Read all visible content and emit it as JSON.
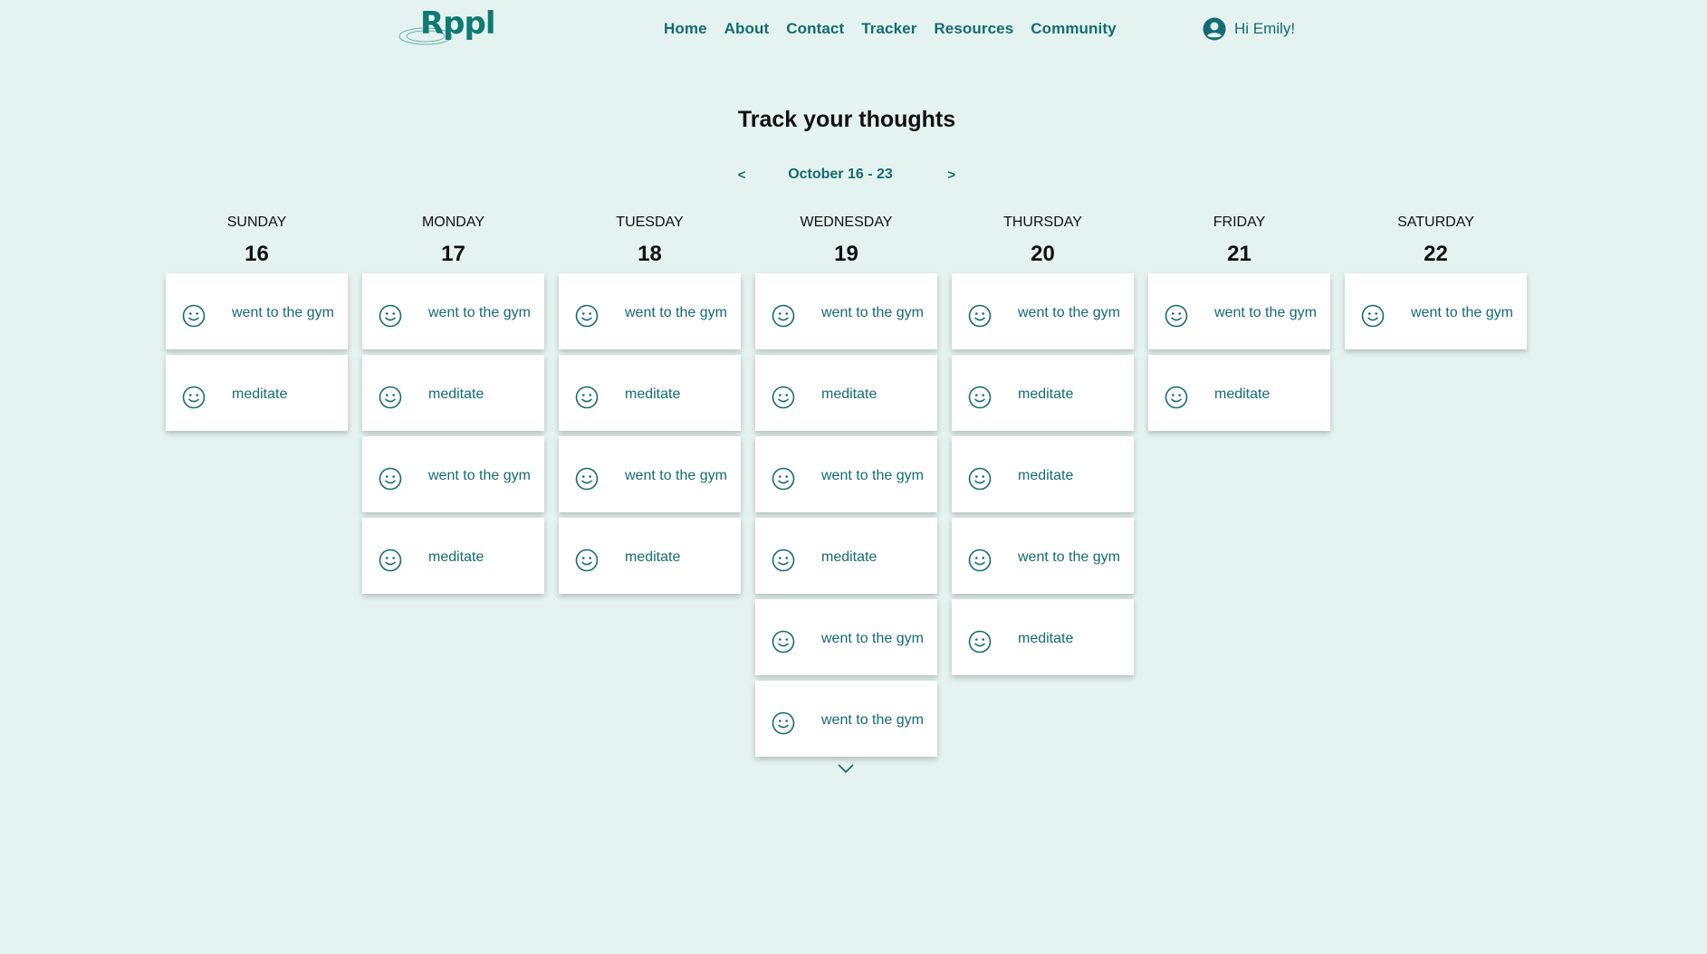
{
  "brand": {
    "logo_text": "Rppl"
  },
  "nav": [
    "Home",
    "About",
    "Contact",
    "Tracker",
    "Resources",
    "Community"
  ],
  "user": {
    "greeting": "Hi Emily!",
    "icon": "user-circle-icon"
  },
  "title": "Track your thoughts",
  "week": {
    "prev": "<",
    "range": "October 16 - 23",
    "next": ">"
  },
  "colors": {
    "accent": "#146b72",
    "background": "#e4f3ef",
    "card": "#ffffff"
  },
  "days": [
    {
      "name": "SUNDAY",
      "date": "16",
      "entries": [
        "went to the gym",
        "meditate"
      ]
    },
    {
      "name": "MONDAY",
      "date": "17",
      "entries": [
        "went to the gym",
        "meditate",
        "went to the gym",
        "meditate"
      ]
    },
    {
      "name": "TUESDAY",
      "date": "18",
      "entries": [
        "went to the gym",
        "meditate",
        "went to the gym",
        "meditate"
      ]
    },
    {
      "name": "WEDNESDAY",
      "date": "19",
      "entries": [
        "went to the gym",
        "meditate",
        "went to the gym",
        "meditate",
        "went to the gym",
        "went to the gym"
      ]
    },
    {
      "name": "THURSDAY",
      "date": "20",
      "entries": [
        "went to the gym",
        "meditate",
        "meditate",
        "went to the gym",
        "meditate"
      ]
    },
    {
      "name": "FRIDAY",
      "date": "21",
      "entries": [
        "went to the gym",
        "meditate"
      ]
    },
    {
      "name": "SATURDAY",
      "date": "22",
      "entries": [
        "went to the gym"
      ]
    }
  ],
  "entry_icon": "smiley-face-icon",
  "expand_icon": "chevron-down-icon"
}
